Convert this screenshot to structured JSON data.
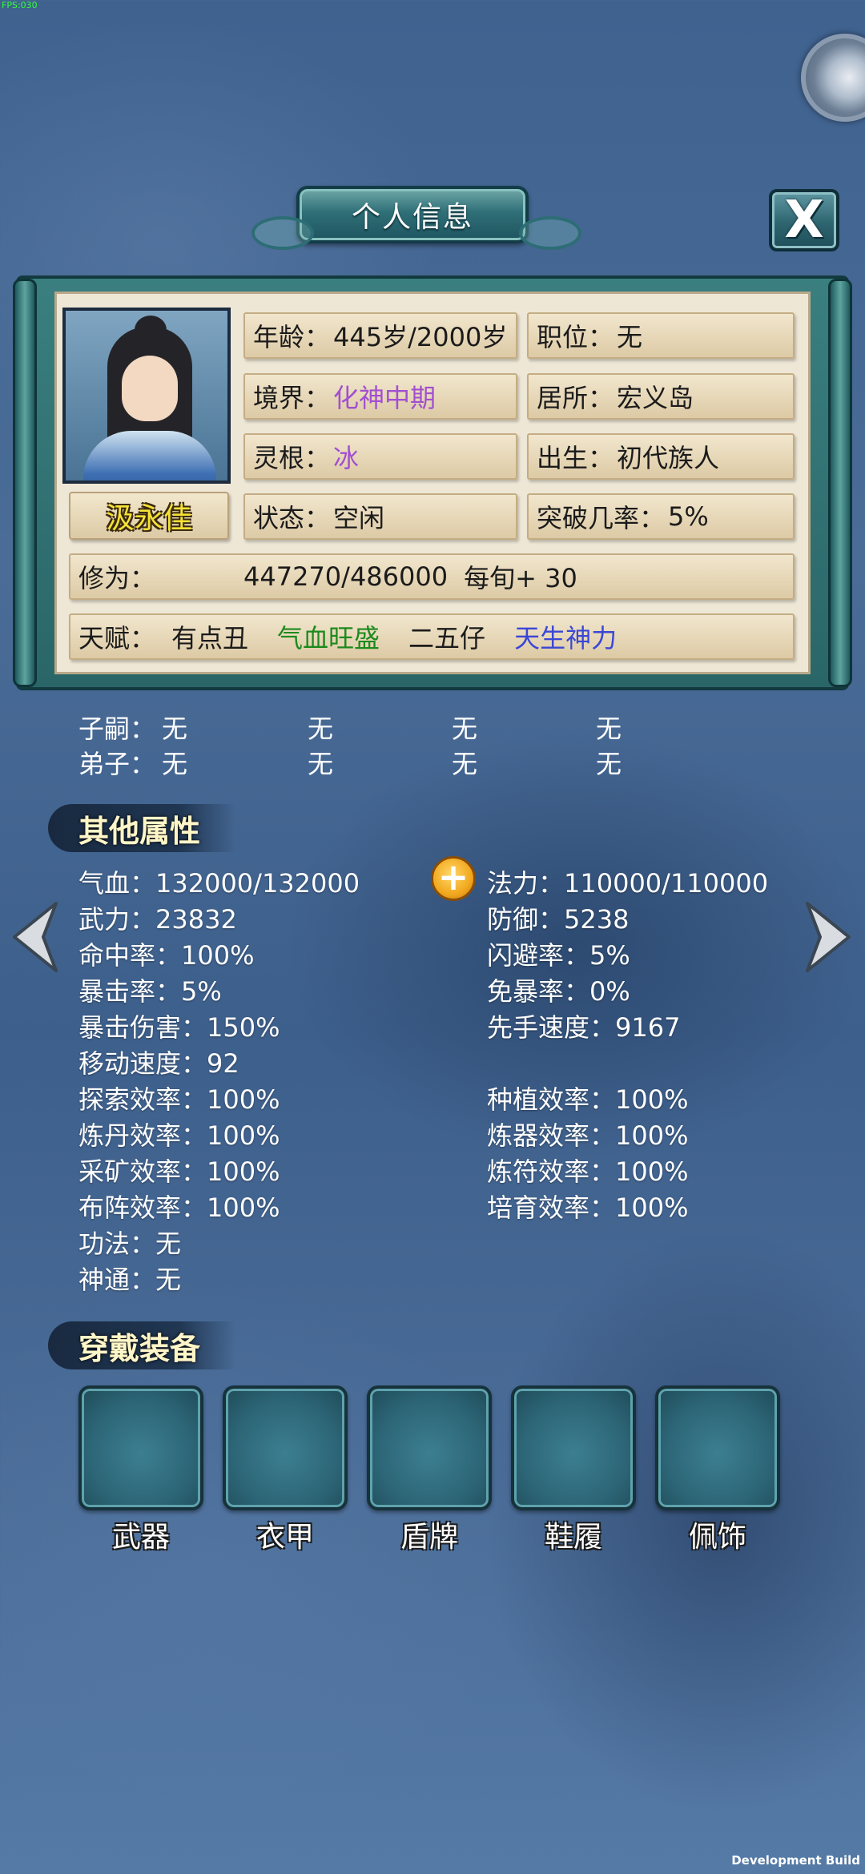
{
  "debug": {
    "fps": "FPS:030",
    "build": "Development Build"
  },
  "header": {
    "title": "个人信息"
  },
  "profile": {
    "name": "汲永佳",
    "age": {
      "label": "年龄：",
      "value": "445岁/2000岁"
    },
    "position": {
      "label": "职位：",
      "value": "无"
    },
    "realm": {
      "label": "境界：",
      "value": "化神中期"
    },
    "residence": {
      "label": "居所：",
      "value": "宏义岛"
    },
    "root": {
      "label": "灵根：",
      "value": "冰"
    },
    "birth": {
      "label": "出生：",
      "value": "初代族人"
    },
    "status": {
      "label": "状态：",
      "value": "空闲"
    },
    "breakthrough": {
      "label": "突破几率：",
      "value": "5%"
    },
    "cultivation": {
      "label": "修为：",
      "value": "447270/486000",
      "rate": "每旬+ 30"
    },
    "talent": {
      "label": "天赋：",
      "items": [
        "有点丑",
        "气血旺盛",
        "二五仔",
        "天生神力"
      ]
    }
  },
  "relations": {
    "heirs": {
      "label": "子嗣：",
      "values": [
        "无",
        "无",
        "无",
        "无"
      ]
    },
    "disciples": {
      "label": "弟子：",
      "values": [
        "无",
        "无",
        "无",
        "无"
      ]
    }
  },
  "other_attrs": {
    "title": "其他属性",
    "hp": "气血：132000/132000",
    "mp": "法力：110000/110000",
    "attack": "武力：23832",
    "defense": "防御：5238",
    "hit": "命中率：100%",
    "dodge": "闪避率：5%",
    "crit": "暴击率：5%",
    "crit_resist": "免暴率：0%",
    "crit_damage": "暴击伤害：150%",
    "initiative": "先手速度：9167",
    "move_speed": "移动速度：92",
    "explore": "探索效率：100%",
    "plant": "种植效率：100%",
    "alchemy": "炼丹效率：100%",
    "forge": "炼器效率：100%",
    "mining": "采矿效率：100%",
    "talisman": "炼符效率：100%",
    "formation": "布阵效率：100%",
    "breeding": "培育效率：100%",
    "technique": "功法：无",
    "supernatural": "神通：无"
  },
  "equipment": {
    "title": "穿戴装备",
    "slots": [
      "武器",
      "衣甲",
      "盾牌",
      "鞋履",
      "佩饰"
    ]
  }
}
